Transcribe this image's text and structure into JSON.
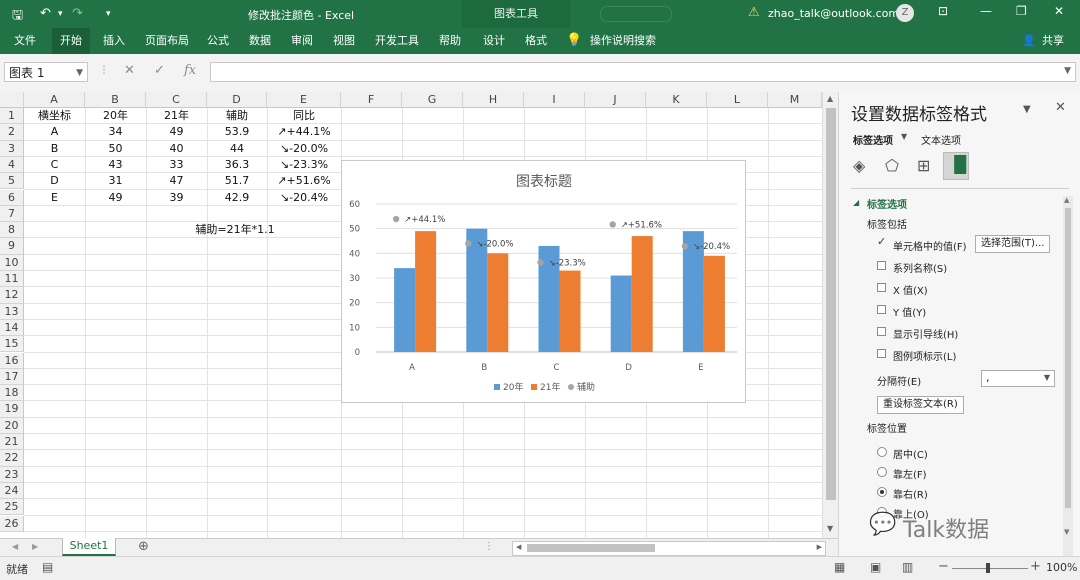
{
  "titlebar": {
    "window_title": "修改批注颜色  -  Excel",
    "context_tools": "图表工具",
    "account": "zhao_talk@outlook.com",
    "avatar_letter": "Z"
  },
  "ribbon": {
    "tabs": [
      "文件",
      "开始",
      "插入",
      "页面布局",
      "公式",
      "数据",
      "审阅",
      "视图",
      "开发工具",
      "帮助",
      "设计",
      "格式"
    ],
    "tell_me": "操作说明搜索",
    "share": "共享"
  },
  "formula_bar": {
    "name_box": "图表 1",
    "fx": "fx",
    "formula": ""
  },
  "grid": {
    "columns": [
      "A",
      "B",
      "C",
      "D",
      "E",
      "F",
      "G",
      "H",
      "I",
      "J",
      "K",
      "L",
      "M"
    ],
    "rows": [
      "1",
      "2",
      "3",
      "4",
      "5",
      "6",
      "7",
      "8",
      "9",
      "10",
      "11",
      "12",
      "13",
      "14",
      "15",
      "16",
      "17",
      "18",
      "19",
      "20",
      "21",
      "22",
      "23",
      "24",
      "25",
      "26"
    ],
    "headers": [
      "横坐标",
      "20年",
      "21年",
      "辅助",
      "同比"
    ],
    "data": [
      [
        "A",
        "34",
        "49",
        "53.9",
        "↗+44.1%"
      ],
      [
        "B",
        "50",
        "40",
        "44",
        "↘-20.0%"
      ],
      [
        "C",
        "43",
        "33",
        "36.3",
        "↘-23.3%"
      ],
      [
        "D",
        "31",
        "47",
        "51.7",
        "↗+51.6%"
      ],
      [
        "E",
        "49",
        "39",
        "42.9",
        "↘-20.4%"
      ]
    ],
    "note": "辅助=21年*1.1"
  },
  "chart_data": {
    "type": "bar",
    "title": "图表标题",
    "categories": [
      "A",
      "B",
      "C",
      "D",
      "E"
    ],
    "series": [
      {
        "name": "20年",
        "values": [
          34,
          50,
          43,
          31,
          49
        ],
        "color": "#5b9bd5"
      },
      {
        "name": "21年",
        "values": [
          49,
          40,
          33,
          47,
          39
        ],
        "color": "#ed7d31"
      },
      {
        "name": "辅助",
        "values": [
          53.9,
          44,
          36.3,
          51.7,
          42.9
        ],
        "color": "#a5a5a5",
        "render": "markers"
      }
    ],
    "data_labels": [
      "↗+44.1%",
      "↘-20.0%",
      "↘-23.3%",
      "↗+51.6%",
      "↘-20.4%"
    ],
    "yticks": [
      "0",
      "10",
      "20",
      "30",
      "40",
      "50",
      "60"
    ],
    "ylim": [
      0,
      60
    ],
    "legend": "bottom",
    "grid": true
  },
  "sheet": {
    "tab": "Sheet1",
    "add": "⊕"
  },
  "status": {
    "mode": "就绪",
    "zoom": "100%"
  },
  "pane": {
    "title": "设置数据标签格式",
    "tab_label_options": "标签选项",
    "tab_text_options": "文本选项",
    "section": "标签选项",
    "includes_title": "标签包括",
    "checks": [
      {
        "label": "单元格中的值(F)",
        "checked": true
      },
      {
        "label": "系列名称(S)",
        "checked": false
      },
      {
        "label": "X 值(X)",
        "checked": false
      },
      {
        "label": "Y 值(Y)",
        "checked": false
      },
      {
        "label": "显示引导线(H)",
        "checked": false
      },
      {
        "label": "图例项标示(L)",
        "checked": false
      }
    ],
    "select_range_button": "选择范围(T)...",
    "separator_label": "分隔符(E)",
    "separator_value": ",",
    "reset_button": "重设标签文本(R)",
    "position_title": "标签位置",
    "positions": [
      {
        "label": "居中(C)",
        "selected": false
      },
      {
        "label": "靠左(F)",
        "selected": false
      },
      {
        "label": "靠右(R)",
        "selected": true
      },
      {
        "label": "靠上(O)",
        "selected": false
      }
    ]
  },
  "watermark": "Talk数据"
}
